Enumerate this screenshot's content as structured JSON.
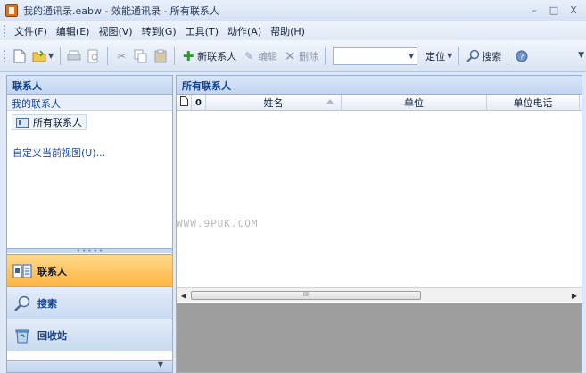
{
  "window": {
    "title": "我的通讯录.eabw - 效能通讯录 - 所有联系人",
    "controls": [
      "–",
      "□",
      "X"
    ]
  },
  "menu": [
    "文件(F)",
    "编辑(E)",
    "视图(V)",
    "转到(G)",
    "工具(T)",
    "动作(A)",
    "帮助(H)"
  ],
  "toolbar": {
    "new_contact": "新联系人",
    "edit": "编辑",
    "delete": "删除",
    "search_combo_value": "",
    "locate": "定位",
    "search": "搜索"
  },
  "sidebar": {
    "header": "联系人",
    "group": "我的联系人",
    "item": "所有联系人",
    "customize_link": "自定义当前视图(U)...",
    "nav": [
      "联系人",
      "搜索",
      "回收站"
    ]
  },
  "main": {
    "header": "所有联系人",
    "columns": [
      "",
      "",
      "姓名",
      "单位",
      "单位电话"
    ],
    "watermark": "WWW.9PUK.COM",
    "scroll_thumb_text": "III"
  },
  "icons": {
    "app": "app-icon",
    "new_doc": "new-document-icon",
    "open": "open-folder-icon",
    "print": "print-icon",
    "print_preview": "print-preview-icon",
    "cut": "cut-icon",
    "copy": "copy-icon",
    "paste": "paste-icon",
    "add": "add-icon",
    "edit": "edit-icon",
    "delete": "delete-icon",
    "search": "magnifier-icon",
    "help": "help-icon",
    "contacts": "contacts-icon",
    "recycle": "recycle-bin-icon"
  },
  "colors": {
    "accent": "#15428b",
    "active_nav": "#ffb443",
    "preview_bg": "#9e9e9e"
  }
}
